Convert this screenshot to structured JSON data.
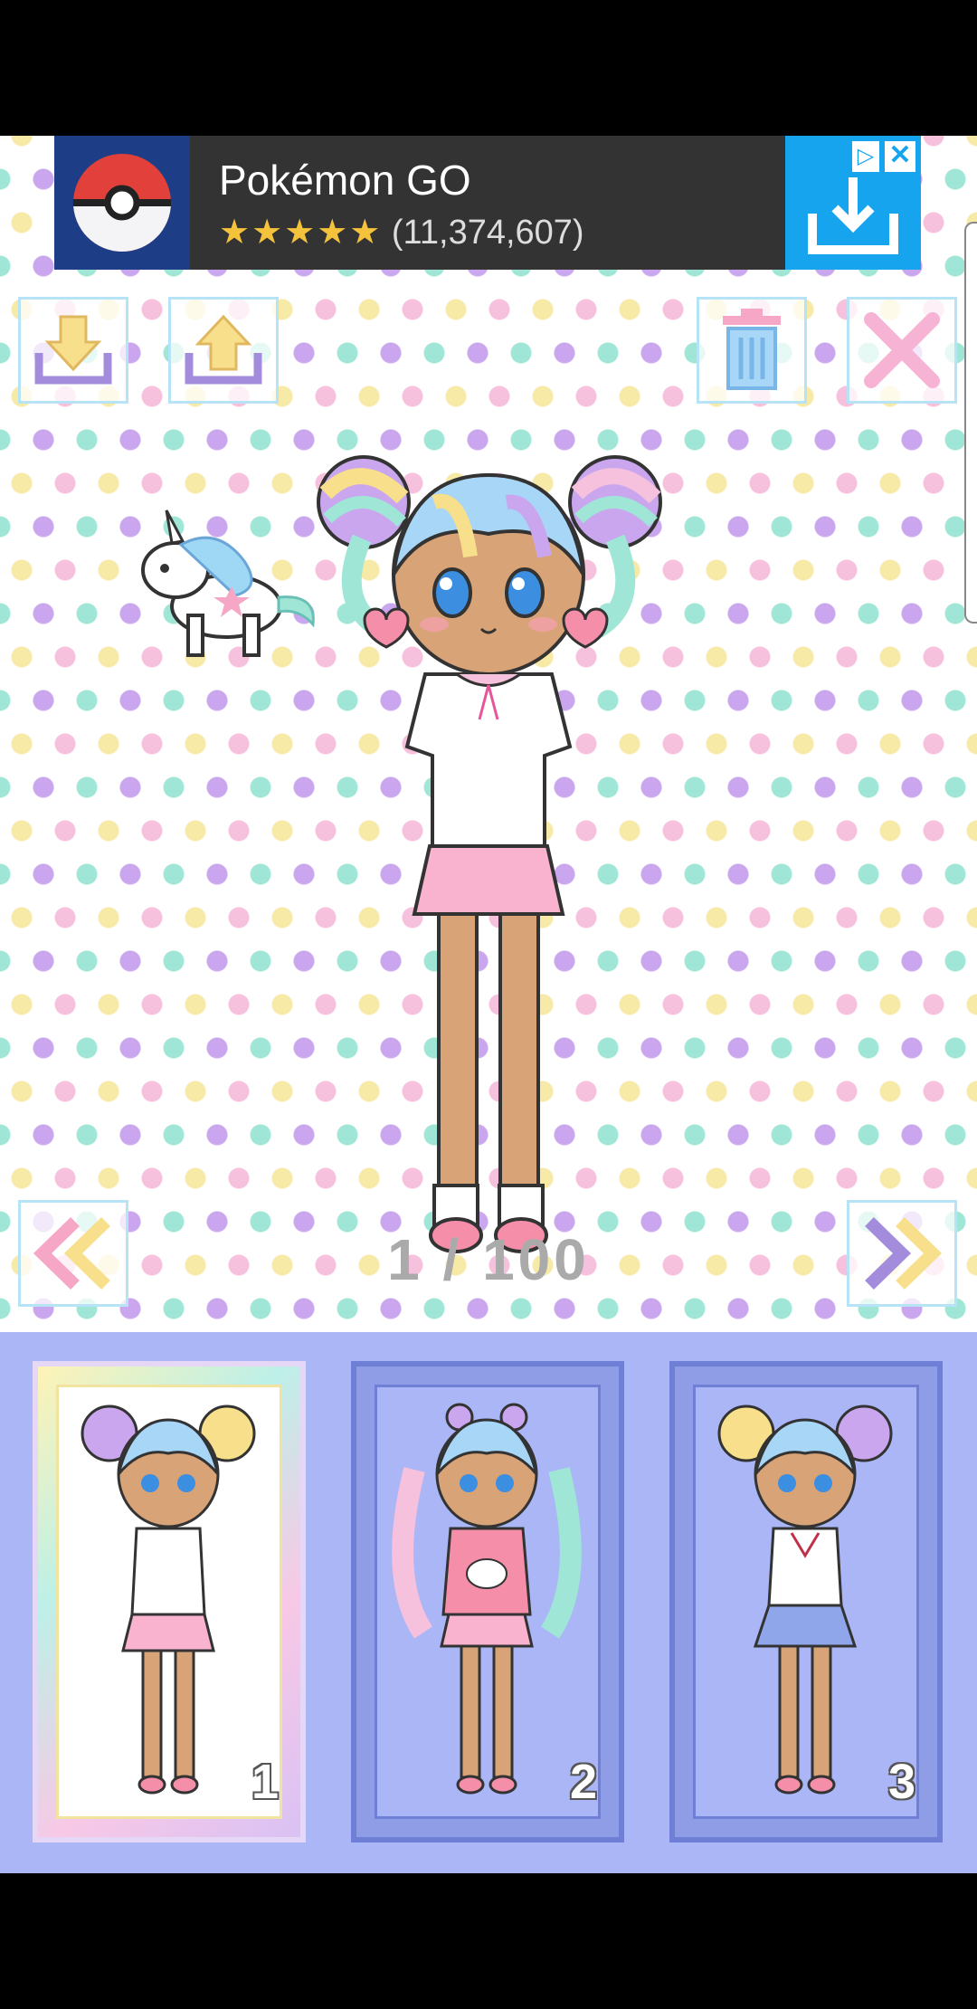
{
  "ad": {
    "title": "Pokémon GO",
    "stars": "★★★★★",
    "reviews": "(11,374,607)",
    "ad_choices": "▷",
    "close": "✕"
  },
  "toolbar": {
    "save_icon": "download-icon",
    "load_icon": "upload-icon",
    "delete_icon": "trash-icon",
    "close_icon": "close-icon"
  },
  "navigation": {
    "page_counter": "1 / 100",
    "prev_icon": "double-chevron-left-icon",
    "next_icon": "double-chevron-right-icon"
  },
  "slots": [
    {
      "number": "1",
      "selected": true
    },
    {
      "number": "2",
      "selected": false
    },
    {
      "number": "3",
      "selected": false
    }
  ],
  "colors": {
    "panel": "#aab6f6",
    "ad_cta": "#17a4ef",
    "frame": "#6f7fd6"
  }
}
